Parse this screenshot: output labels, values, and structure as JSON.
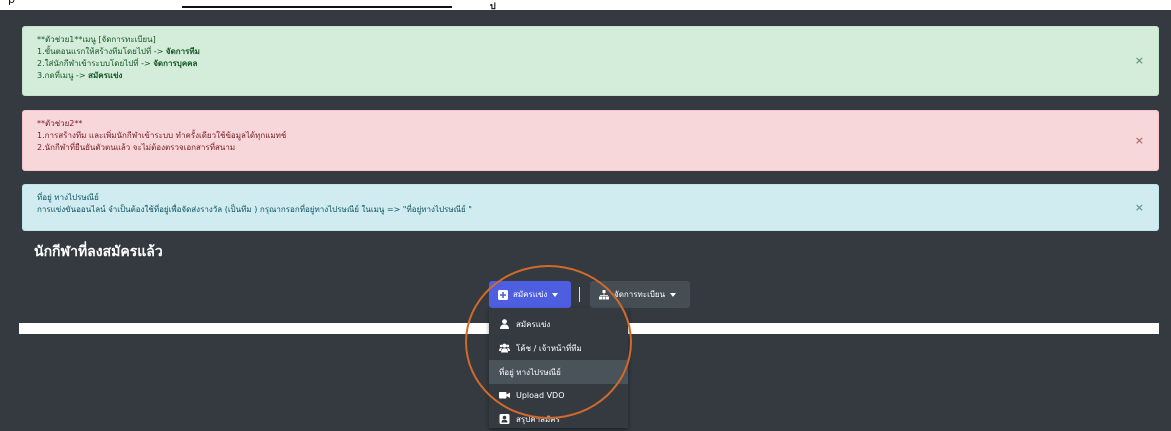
{
  "top_strip": {
    "text": "p",
    "mark": "ป"
  },
  "alerts": [
    {
      "lines": [
        "**ตัวช่วย1**เมนู [จัดการทะเบียน]",
        "1.ขั้นตอนแรกให้สร้างทีมโดยไปที่ -> ",
        "2.ใส่นักกีฬาเข้าระบบโดยไปที่ -> ",
        "3.กดที่เมนู -> "
      ],
      "bold": [
        "",
        "จัดการทีม",
        "จัดการบุคคล",
        "สมัครแข่ง"
      ],
      "close": "×"
    },
    {
      "lines": [
        "**ตัวช่วย2**",
        "1.การสร้างทีม และเพิ่มนักกีฬาเข้าระบบ ทำครั้งเดียวใช้ข้อมูลได้ทุกแมทช์",
        "2.นักกีฬาที่ยืนยันตัวตนแล้ว จะไม่ต้องตรวจเอกสารที่สนาม"
      ],
      "close": "×"
    },
    {
      "lines": [
        "ที่อยู่ ทางไปรษณีย์",
        "การแข่งขันออนไลน์ จำเป็นต้องใช้ที่อยู่เพื่อจัดส่งรางวัล (เป็นทีม ) กรุณากรอกที่อยู่ทางไปรษณีย์ ในเมนู => \"ที่อยู่ทางไปรษณีย์ \""
      ],
      "close": "×"
    }
  ],
  "heading": "นักกีฬาที่ลงสมัครแล้ว",
  "toolbar": {
    "register_label": "สมัครแข่ง",
    "registry_label": "จัดการทะเบียน"
  },
  "dropdown": {
    "items": [
      {
        "label": "สมัครแข่ง",
        "icon": "user-icon"
      },
      {
        "label": "โค้ช / เจ้าหน้าที่ทีม",
        "icon": "users-icon"
      },
      {
        "label": "ที่อยู่ ทางไปรษณีย์",
        "icon": ""
      },
      {
        "label": "Upload VDO",
        "icon": "video-icon"
      },
      {
        "label": "สรุปค่าสมัคร",
        "icon": "user-summary-icon"
      }
    ]
  },
  "colors": {
    "background": "#343a40",
    "primary": "#4e5ee0",
    "annotation": "#d06a2a"
  }
}
